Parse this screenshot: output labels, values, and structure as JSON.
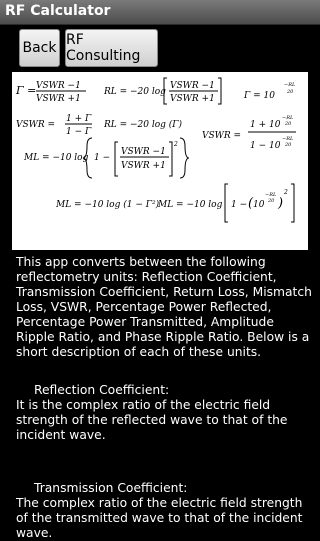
{
  "app": {
    "title": "RF Calculator"
  },
  "toolbar": {
    "back_label": "Back",
    "rf_consulting_label": "RF Consulting"
  },
  "formulas": {
    "gamma_lhs": "Γ =",
    "vswr_m1": "VSWR −1",
    "vswr_p1": "VSWR +1",
    "rl_lhs": "RL = −20 log",
    "gamma_rl_lhs": "Γ = 10",
    "rl_over_20": "−RL",
    "twenty": "20",
    "vswr_lhs": "VSWR =",
    "one_p_gamma": "1 + Γ",
    "one_m_gamma": "1 − Γ",
    "rl_gamma": "RL = −20 log (Γ)",
    "vswr_lhs2": "VSWR =",
    "one_p_10": "1 + 10",
    "one_m_10": "1 − 10",
    "ml_lhs": "ML = −10 log",
    "ml_gamma": "ML = −10 log (1 − Γ²)",
    "ml_rl": "ML = −10 log",
    "one_minus": "1 −",
    "ten": "10",
    "sq": "2"
  },
  "content": {
    "intro": "This app converts between the following reflectometry units: Reflection Coefficient, Transmission Coefficient, Return Loss, Mismatch Loss, VSWR, Percentage Power Reflected, Percentage Power Transmitted, Amplitude Ripple Ratio, and Phase Ripple Ratio. Below is a short description of each of these units.",
    "sections": [
      {
        "heading": "Reflection Coefficient:",
        "text": "It is the complex ratio of the electric field strength of the reflected wave to that of the incident wave."
      },
      {
        "heading": "Transmission Coefficient:",
        "text": "The complex ratio of the electric field strength of the transmitted wave to that of the incident wave."
      }
    ]
  }
}
